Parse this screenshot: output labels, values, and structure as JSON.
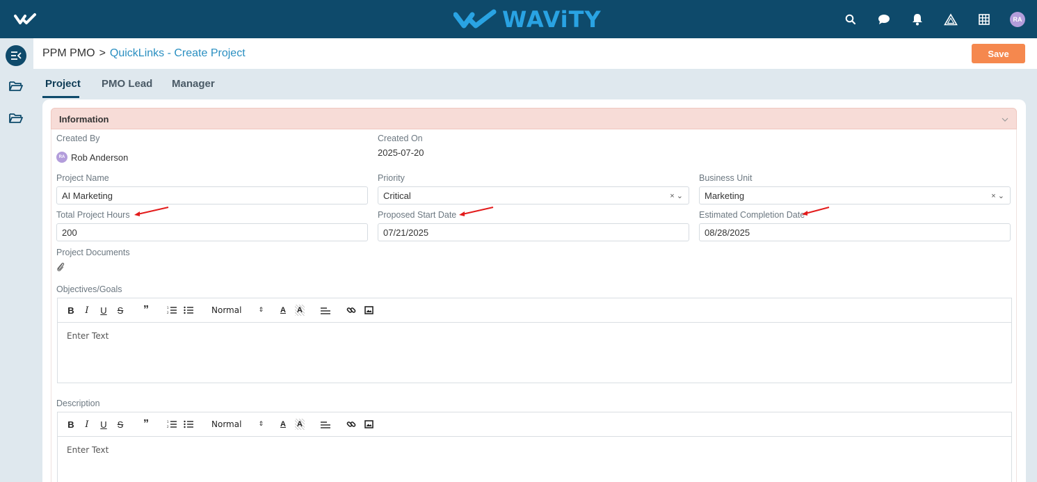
{
  "app": {
    "brand": "WAViTY",
    "user_initials": "RA"
  },
  "breadcrumb": {
    "root": "PPM PMO",
    "separator": ">",
    "current": "QuickLinks - Create Project"
  },
  "actions": {
    "save_label": "Save"
  },
  "tabs": [
    {
      "label": "Project",
      "active": true
    },
    {
      "label": "PMO Lead",
      "active": false
    },
    {
      "label": "Manager",
      "active": false
    }
  ],
  "section": {
    "title": "Information"
  },
  "fields": {
    "created_by": {
      "label": "Created By",
      "value": "Rob Anderson",
      "initials": "RA"
    },
    "created_on": {
      "label": "Created On",
      "value": "2025-07-20"
    },
    "project_name": {
      "label": "Project Name",
      "value": "AI Marketing"
    },
    "priority": {
      "label": "Priority",
      "value": "Critical"
    },
    "business_unit": {
      "label": "Business Unit",
      "value": "Marketing"
    },
    "total_hours": {
      "label": "Total Project Hours",
      "value": "200"
    },
    "start_date": {
      "label": "Proposed Start Date",
      "value": "07/21/2025"
    },
    "completion_date": {
      "label": "Estimated Completion Date",
      "value": "08/28/2025"
    },
    "documents": {
      "label": "Project Documents"
    }
  },
  "editors": {
    "objectives": {
      "label": "Objectives/Goals",
      "placeholder": "Enter Text",
      "format": "Normal"
    },
    "description": {
      "label": "Description",
      "placeholder": "Enter Text",
      "format": "Normal"
    }
  },
  "select_controls": {
    "clear": "×",
    "open": "⌄"
  },
  "colors": {
    "topbar": "#0e4a6b",
    "brand": "#29a3e3",
    "save": "#f5884e",
    "section_header": "#f7dcd7",
    "link": "#2a8fc1",
    "annotation_arrow": "#e31b1b"
  }
}
